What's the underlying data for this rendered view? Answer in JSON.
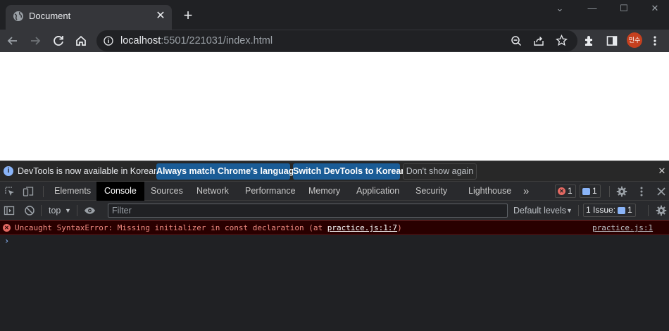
{
  "browser": {
    "tab_title": "Document",
    "tab_close": "✕",
    "new_tab": "+",
    "window": {
      "collapse": "⌄",
      "minimize": "—",
      "maximize": "☐",
      "close": "✕"
    },
    "url_host": "localhost",
    "url_rest": ":5501/221031/index.html",
    "avatar_text": "민수",
    "accent_color": "#c5401f"
  },
  "infobar": {
    "icon": "i",
    "message": "DevTools is now available in Korean!",
    "btn_match": "Always match Chrome's language",
    "btn_switch": "Switch DevTools to Korean",
    "btn_dismiss": "Don't show again",
    "close": "✕"
  },
  "devtools": {
    "tabs": [
      "Elements",
      "Console",
      "Sources",
      "Network",
      "Performance",
      "Memory",
      "Application",
      "Security",
      "Lighthouse"
    ],
    "active_tab": "Console",
    "more": "»",
    "error_count": "1",
    "message_count": "1"
  },
  "console_toolbar": {
    "context": "top",
    "filter_placeholder": "Filter",
    "levels": "Default levels",
    "issues_label": "1 Issue:",
    "issues_count": "1"
  },
  "console": {
    "error_prefix": "Uncaught SyntaxError: Missing initializer in const declaration (at ",
    "error_link": "practice.js:1:7",
    "error_suffix": ")",
    "error_source": "practice.js:1",
    "prompt": "›"
  }
}
